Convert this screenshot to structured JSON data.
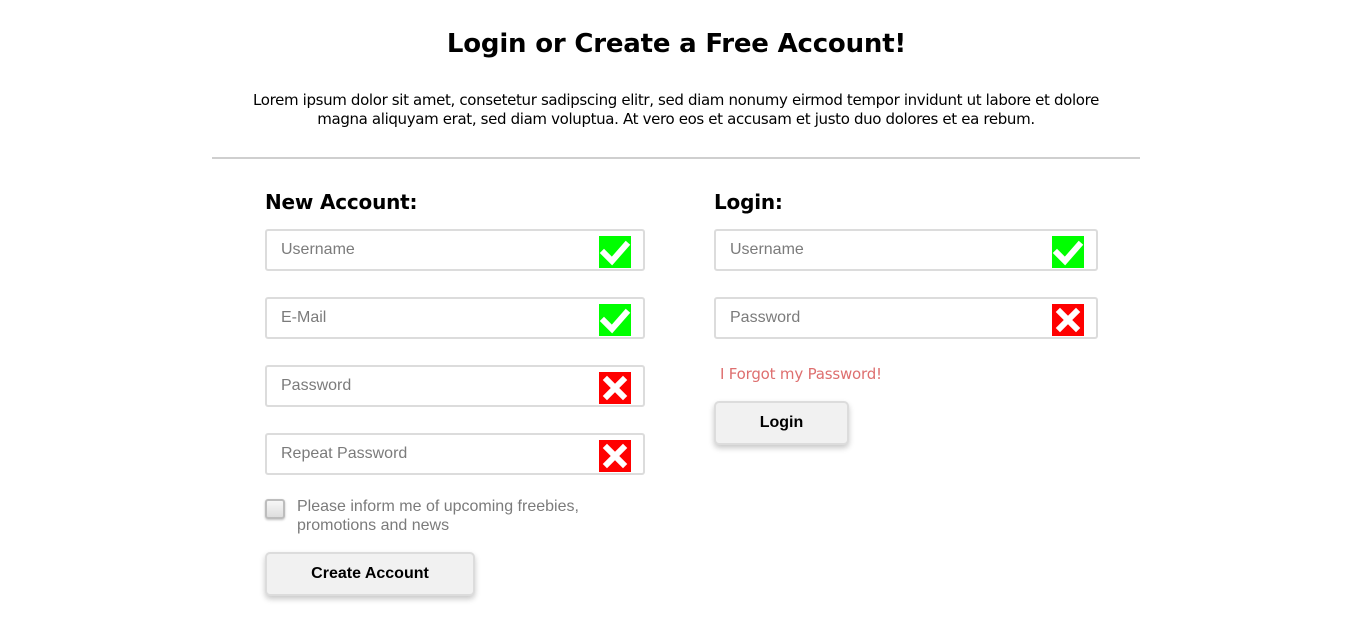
{
  "header": {
    "title": "Login or Create a Free Account!",
    "intro": "Lorem ipsum dolor sit amet, consetetur sadipscing elitr, sed diam nonumy eirmod tempor invidunt ut labore et dolore magna aliquyam erat, sed diam voluptua. At vero eos et accusam et justo duo dolores et ea rebum."
  },
  "new_account": {
    "title": "New Account:",
    "username": {
      "placeholder": "Username",
      "value": "",
      "status": "valid"
    },
    "email": {
      "placeholder": "E-Mail",
      "value": "",
      "status": "valid"
    },
    "password": {
      "placeholder": "Password",
      "value": "",
      "status": "invalid"
    },
    "repeat_password": {
      "placeholder": "Repeat Password",
      "value": "",
      "status": "invalid"
    },
    "newsletter": {
      "label": "Please inform me of upcoming freebies, promotions and news",
      "checked": false
    },
    "submit_label": "Create Account"
  },
  "login": {
    "title": "Login:",
    "username": {
      "placeholder": "Username",
      "value": "",
      "status": "valid"
    },
    "password": {
      "placeholder": "Password",
      "value": "",
      "status": "invalid"
    },
    "forgot_label": "I Forgot my Password!",
    "submit_label": "Login"
  },
  "icons": {
    "valid": "check-icon",
    "invalid": "cross-icon"
  },
  "colors": {
    "valid": "#00ff00",
    "invalid": "#ff0000",
    "forgot_link": "#de6f6f"
  }
}
